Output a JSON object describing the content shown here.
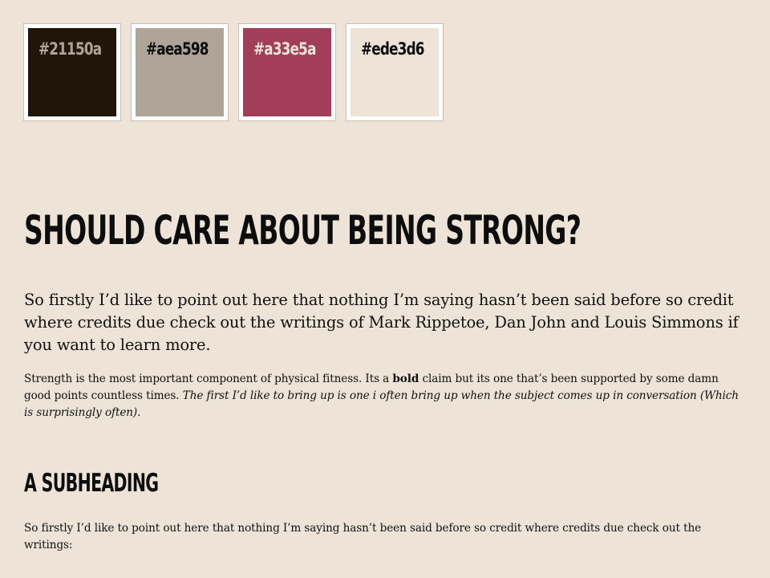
{
  "swatches": [
    {
      "code": "#21150a",
      "color": "#21150a",
      "text_color": "#aea598"
    },
    {
      "code": "#aea598",
      "color": "#aea598",
      "text_color": "#0d0d0d"
    },
    {
      "code": "#a33e5a",
      "color": "#a33e5a",
      "text_color": "#ede3d6"
    },
    {
      "code": "#ede3d6",
      "color": "#ede3d6",
      "text_color": "#0d0d0d"
    }
  ],
  "article": {
    "title": "Should care about being strong?",
    "lead": "So firstly I’d like to point out here that nothing I’m saying hasn’t been said before so credit where credits due check out the writings of Mark Rippetoe, Dan John and Louis Simmons if you want to learn more.",
    "p1_before_bold": "Strength is the most important component of physical fitness. Its a ",
    "p1_bold": "bold",
    "p1_after_bold": " claim but its one that’s been supported by some damn good points countless times. ",
    "p1_italic": "The first I’d like to bring up is one i often bring up when the subject comes up in conversation (Which is surprisingly often).",
    "subheading": "A subheading",
    "p2": "So firstly I’d like to point out here that nothing I’m saying hasn’t been said before so credit where credits due check out the writings:"
  }
}
